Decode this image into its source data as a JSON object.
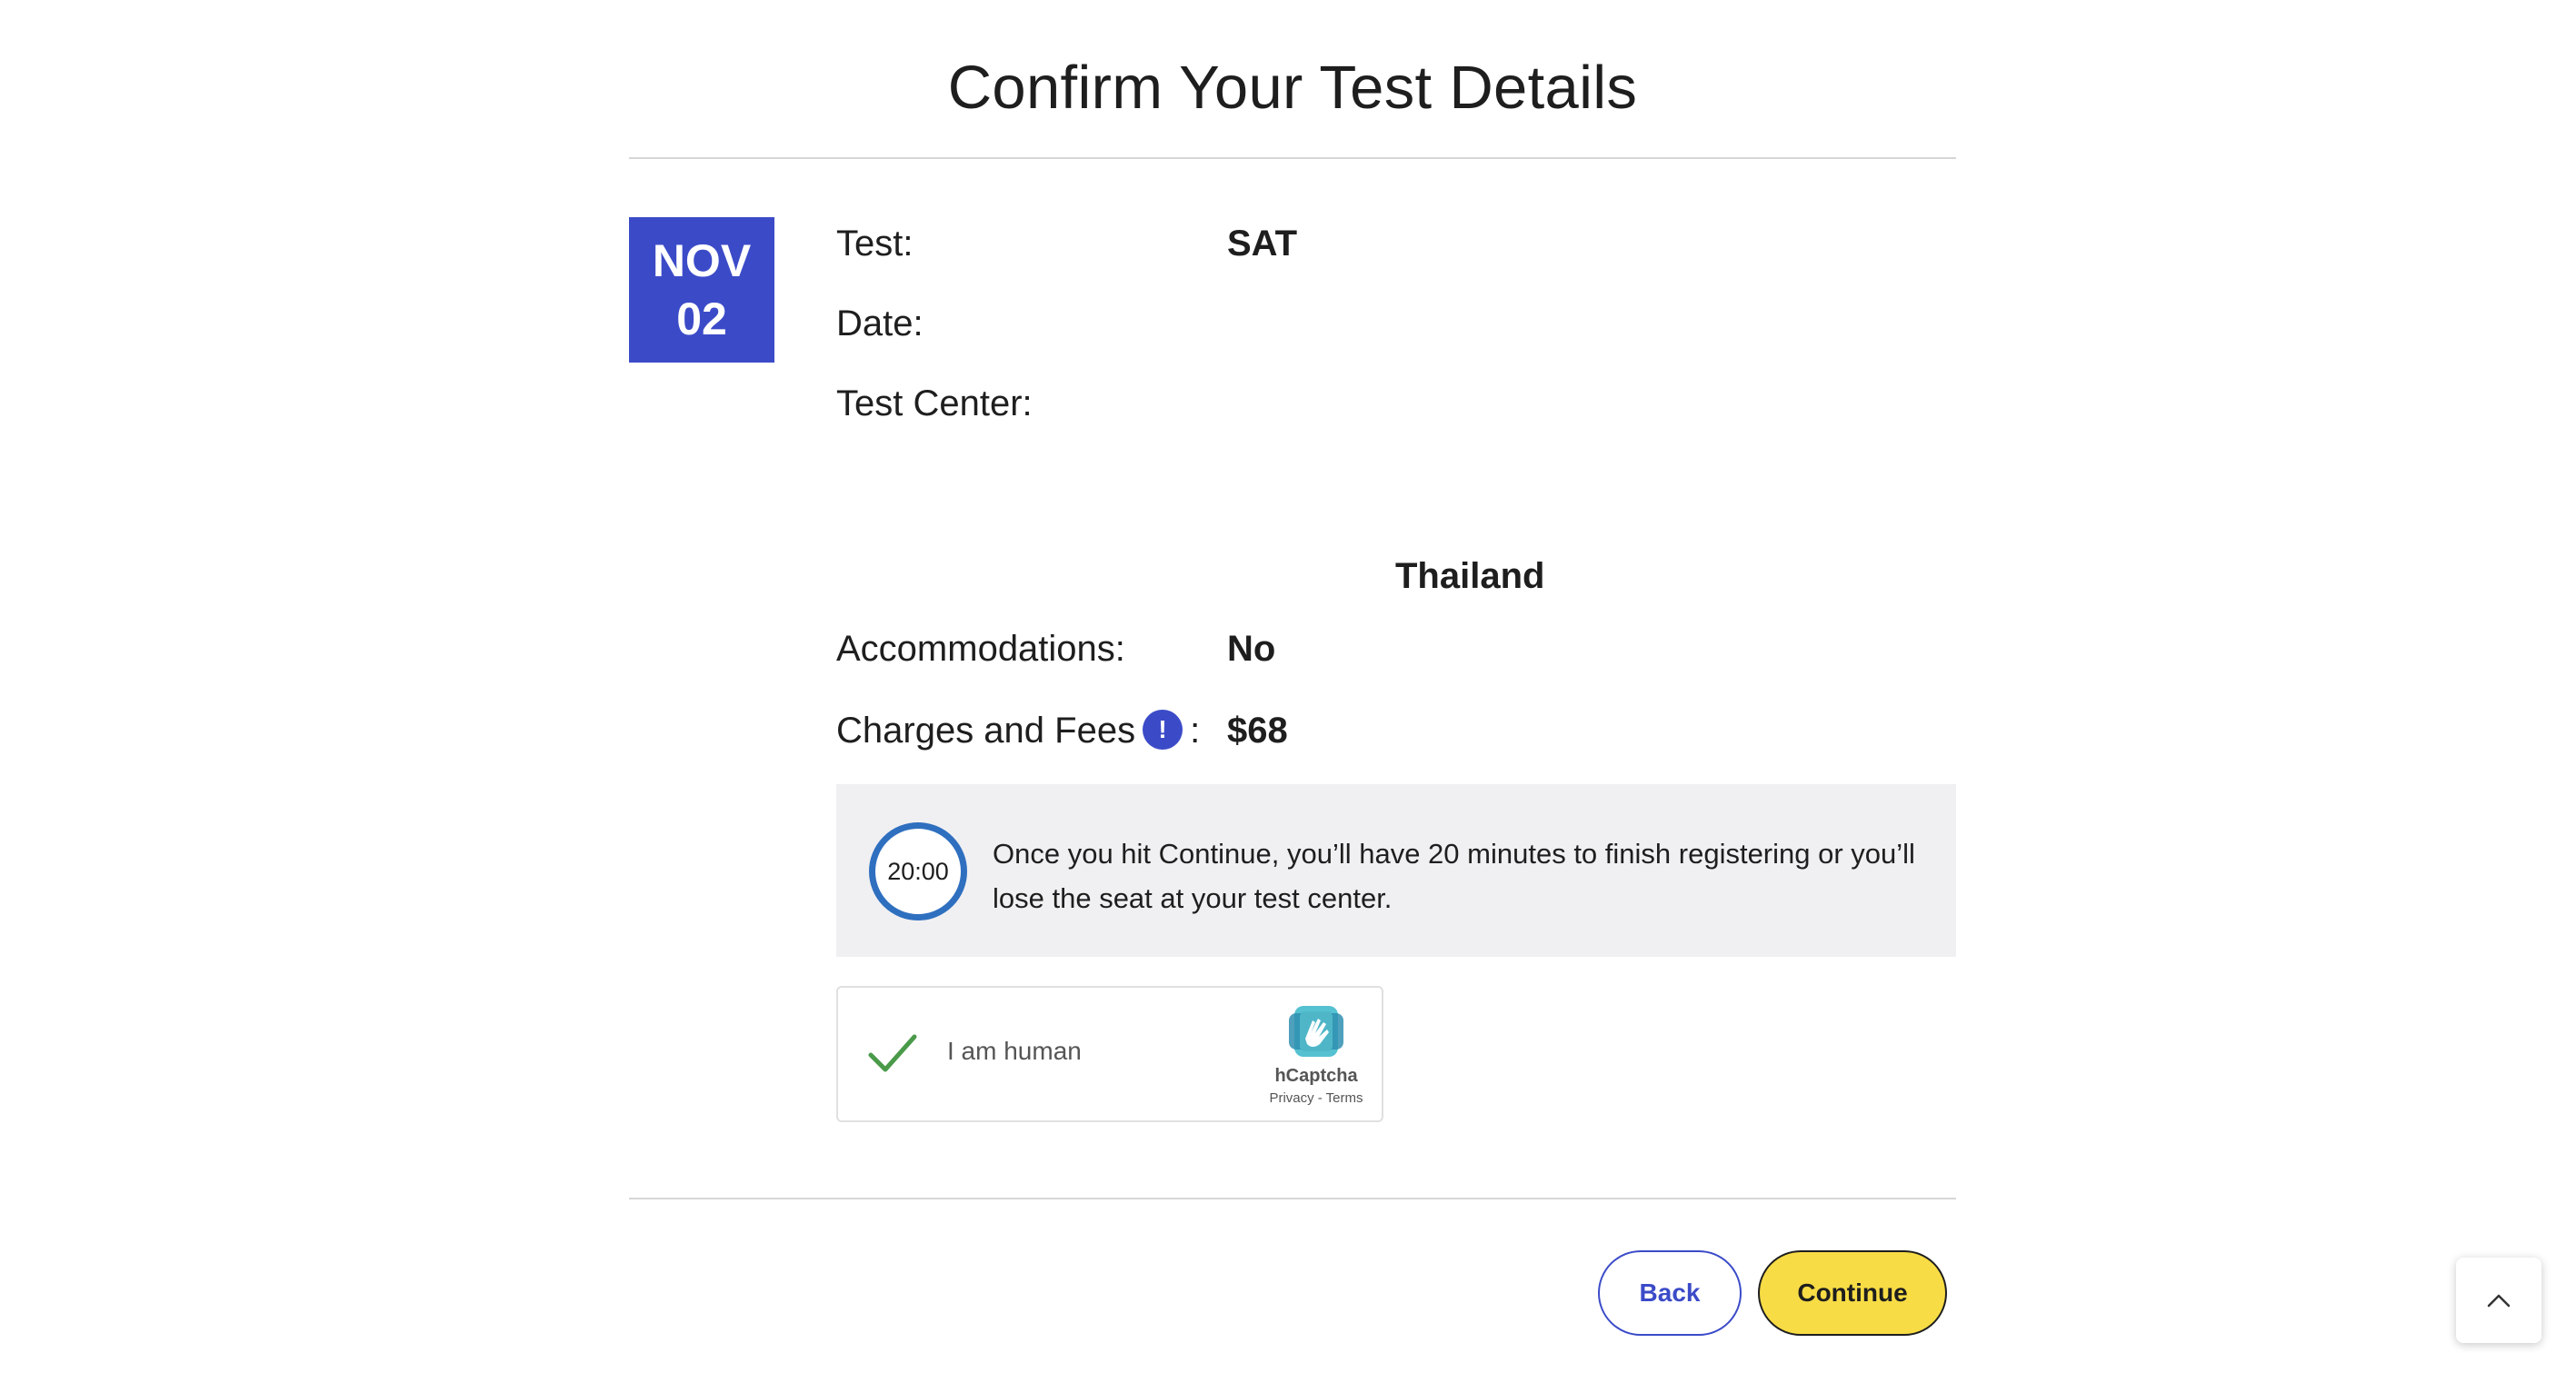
{
  "page": {
    "title": "Confirm Your Test Details"
  },
  "date_badge": {
    "month": "NOV",
    "day": "02"
  },
  "details": {
    "test_label": "Test:",
    "test_value": "SAT",
    "date_label": "Date:",
    "date_value": "",
    "center_label": "Test Center:",
    "center_value": "",
    "center_country": "Thailand",
    "accommodations_label": "Accommodations:",
    "accommodations_value": "No",
    "fees_label": "Charges and Fees",
    "fees_colon": ":",
    "fees_info_icon": "!",
    "fees_value": "$68"
  },
  "timer": {
    "display": "20:00",
    "message": "Once you hit Continue, you’ll have 20 minutes to finish registering or you’ll lose the seat at your test center.",
    "ring_color": "#2f6fbf"
  },
  "captcha": {
    "label": "I am human",
    "brand": "hCaptcha",
    "links": "Privacy - Terms",
    "checked": true,
    "check_color": "#4a9a4a"
  },
  "actions": {
    "back_label": "Back",
    "continue_label": "Continue"
  },
  "colors": {
    "accent_blue": "#3b4bc8",
    "continue_yellow": "#f7dc45",
    "panel_gray": "#f0f0f2"
  },
  "icons": {
    "scroll_top": "chevron-up-icon",
    "fees_info": "info-icon",
    "captcha_check": "checkmark-icon",
    "captcha_logo": "hcaptcha-logo-icon"
  }
}
